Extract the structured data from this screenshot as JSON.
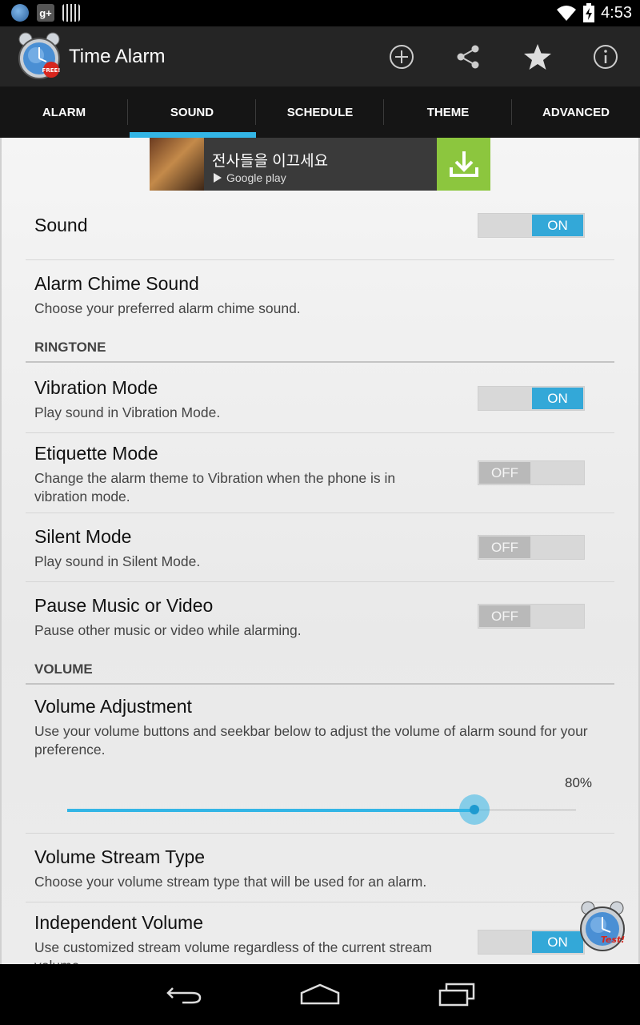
{
  "status_bar": {
    "time": "4:53",
    "notification_icons": [
      "time-alarm-app-icon",
      "google-plus-icon",
      "barcode-icon"
    ],
    "status_icons": [
      "wifi-icon",
      "battery-charging-icon"
    ]
  },
  "action_bar": {
    "title": "Time Alarm",
    "logo_badge": "FREE!",
    "actions": [
      "add-icon",
      "share-icon",
      "star-icon",
      "info-icon"
    ]
  },
  "tabs": [
    {
      "label": "ALARM",
      "active": false
    },
    {
      "label": "SOUND",
      "active": true
    },
    {
      "label": "SCHEDULE",
      "active": false
    },
    {
      "label": "THEME",
      "active": false
    },
    {
      "label": "ADVANCED",
      "active": false
    }
  ],
  "ad": {
    "text": "전사들을 이끄세요",
    "store": "Google play"
  },
  "settings": {
    "sound": {
      "title": "Sound",
      "state": "ON"
    },
    "chime": {
      "title": "Alarm Chime Sound",
      "subtitle": "Choose your preferred alarm chime sound."
    },
    "ringtone_header": "RINGTONE",
    "vibration": {
      "title": "Vibration Mode",
      "subtitle": "Play sound in Vibration Mode.",
      "state": "ON"
    },
    "etiquette": {
      "title": "Etiquette Mode",
      "subtitle": "Change the alarm theme to Vibration when the phone is in vibration mode.",
      "state": "OFF"
    },
    "silent": {
      "title": "Silent Mode",
      "subtitle": "Play sound in Silent Mode.",
      "state": "OFF"
    },
    "pause": {
      "title": "Pause Music or Video",
      "subtitle": "Pause other music or video while alarming.",
      "state": "OFF"
    },
    "volume_header": "VOLUME",
    "volume_adjust": {
      "title": "Volume Adjustment",
      "subtitle": "Use your volume buttons and seekbar below to adjust the volume of alarm sound for your preference.",
      "percent_label": "80%",
      "value": 0.8
    },
    "stream_type": {
      "title": "Volume Stream Type",
      "subtitle": "Choose your volume stream type that will be used for an alarm."
    },
    "independent": {
      "title": "Independent Volume",
      "subtitle": "Use customized stream volume regardless of the current stream volume.",
      "state": "ON"
    }
  },
  "floating_badge": "Test!",
  "nav_bar": [
    "back-icon",
    "home-icon",
    "recent-apps-icon"
  ],
  "colors": {
    "accent": "#33b5e5",
    "action_bar": "#252525",
    "tab_bar": "#151515",
    "ad_download": "#8cc63e"
  }
}
